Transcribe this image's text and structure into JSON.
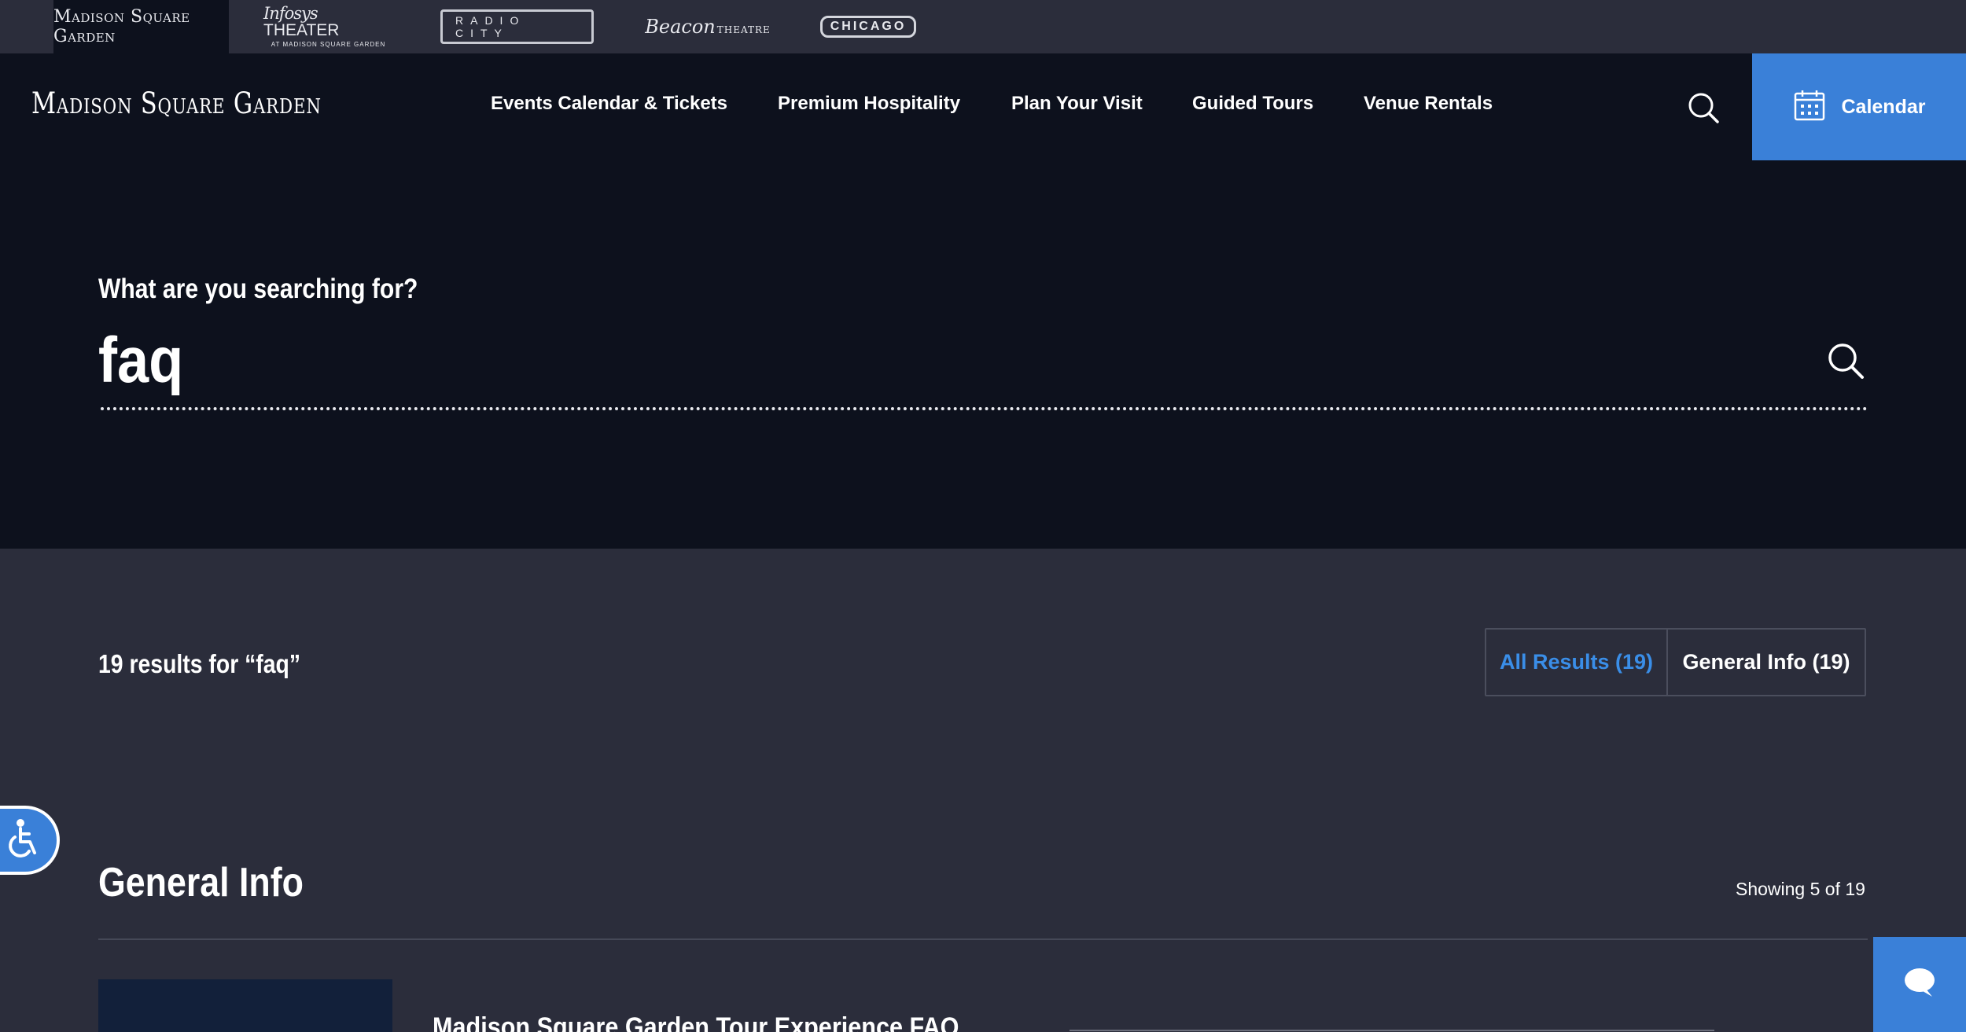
{
  "venues": [
    {
      "name": "Madison Square Garden",
      "active": true
    },
    {
      "name": "Infosys",
      "name2": "THEATER",
      "sub": "AT MADISON SQUARE GARDEN"
    },
    {
      "name": "RADIO CITY"
    },
    {
      "name": "Beacon",
      "suffix": "THEATRE"
    },
    {
      "name": "CHICAGO"
    }
  ],
  "header": {
    "logo": "Madison Square Garden",
    "nav": [
      {
        "label": "Events Calendar & Tickets"
      },
      {
        "label": "Premium Hospitality"
      },
      {
        "label": "Plan Your Visit"
      },
      {
        "label": "Guided Tours"
      },
      {
        "label": "Venue Rentals"
      }
    ],
    "search_icon": "search-icon",
    "calendar_label": "Calendar",
    "calendar_icon": "calendar-icon"
  },
  "search": {
    "label": "What are you searching for?",
    "query": "faq",
    "icon": "search-icon"
  },
  "results": {
    "count_text": "19 results for “faq”",
    "filters": [
      {
        "label": "All Results (19)",
        "active": true
      },
      {
        "label": "General Info (19)",
        "active": false
      }
    ],
    "section_title": "General Info",
    "showing_text": "Showing 5 of 19",
    "first_item_title": "Madison Square Garden Tour Experience FAQ"
  },
  "widgets": {
    "accessibility_icon": "accessibility-icon",
    "chat_icon": "chat-bubble-icon"
  },
  "colors": {
    "accent": "#3a80d8",
    "link_active": "#3a8ee8",
    "bg_dark": "#0d111d",
    "bg_panel": "#2b2d3b"
  }
}
